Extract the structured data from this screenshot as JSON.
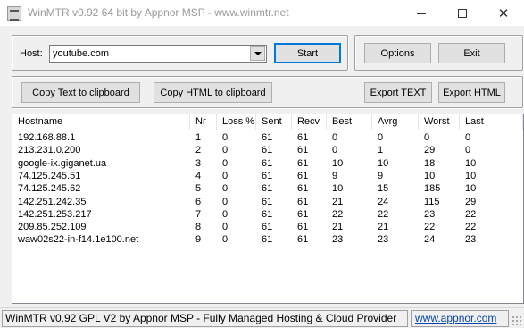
{
  "window": {
    "title": "WinMTR v0.92 64 bit by Appnor MSP - www.winmtr.net",
    "controls": {
      "minimize_icon": "minimize-icon",
      "maximize_icon": "maximize-icon",
      "close_icon": "close-icon",
      "close_glyph": "✕"
    }
  },
  "host": {
    "label": "Host:",
    "value": "youtube.com",
    "dropdown_icon": "chevron-down-icon"
  },
  "buttons": {
    "start": "Start",
    "options": "Options",
    "exit": "Exit",
    "copy_text": "Copy Text to clipboard",
    "copy_html": "Copy HTML to clipboard",
    "export_text": "Export TEXT",
    "export_html": "Export HTML"
  },
  "table": {
    "columns": [
      "Hostname",
      "Nr",
      "Loss %",
      "Sent",
      "Recv",
      "Best",
      "Avrg",
      "Worst",
      "Last"
    ],
    "rows": [
      [
        "192.168.88.1",
        "1",
        "0",
        "61",
        "61",
        "0",
        "0",
        "0",
        "0"
      ],
      [
        "213.231.0.200",
        "2",
        "0",
        "61",
        "61",
        "0",
        "1",
        "29",
        "0"
      ],
      [
        "google-ix.giganet.ua",
        "3",
        "0",
        "61",
        "61",
        "10",
        "10",
        "18",
        "10"
      ],
      [
        "74.125.245.51",
        "4",
        "0",
        "61",
        "61",
        "9",
        "9",
        "10",
        "10"
      ],
      [
        "74.125.245.62",
        "5",
        "0",
        "61",
        "61",
        "10",
        "15",
        "185",
        "10"
      ],
      [
        "142.251.242.35",
        "6",
        "0",
        "61",
        "61",
        "21",
        "24",
        "115",
        "29"
      ],
      [
        "142.251.253.217",
        "7",
        "0",
        "61",
        "61",
        "22",
        "22",
        "23",
        "22"
      ],
      [
        "209.85.252.109",
        "8",
        "0",
        "61",
        "61",
        "21",
        "21",
        "22",
        "22"
      ],
      [
        "waw02s22-in-f14.1e100.net",
        "9",
        "0",
        "61",
        "61",
        "23",
        "23",
        "24",
        "23"
      ]
    ]
  },
  "status": {
    "text": "WinMTR v0.92 GPL V2 by Appnor MSP - Fully Managed Hosting & Cloud Provider",
    "link": "www.appnor.com"
  },
  "colors": {
    "background": "#f0f0f0",
    "default_button_border": "#0078d7",
    "link": "#0645ad"
  }
}
